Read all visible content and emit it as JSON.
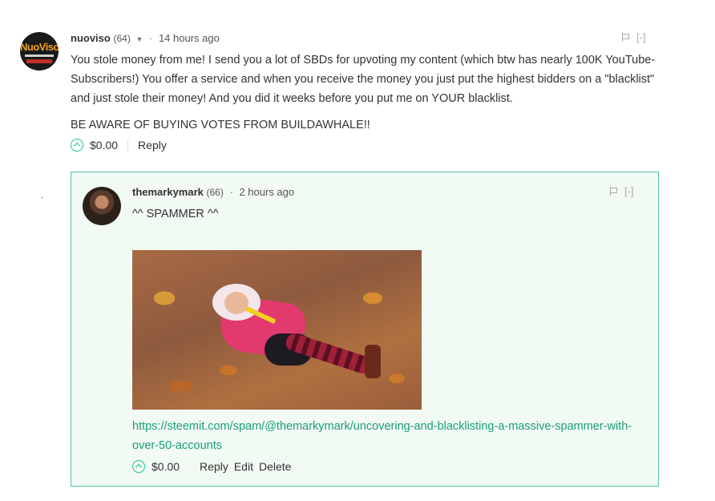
{
  "parent_comment": {
    "author": "nuoviso",
    "reputation": "(64)",
    "time": "14 hours ago",
    "avatar_text": "NuoViso",
    "collapse_label": "[-]",
    "paragraphs": [
      "You stole money from me! I send you a lot of SBDs for upvoting my content (which btw has nearly 100K YouTube-Subscribers!) You offer a service and when you receive the money you just put the highest bidders on a \"blacklist\" and just stole their money! And you did it weeks before you put me on YOUR blacklist.",
      "BE AWARE OF BUYING VOTES FROM BUILDAWHALE!!"
    ],
    "payout": "$0.00",
    "reply_label": "Reply"
  },
  "reply_comment": {
    "author": "themarkymark",
    "reputation": "(66)",
    "time": "2 hours ago",
    "collapse_label": "[-]",
    "text": "^^ SPAMMER ^^",
    "link": "https://steemit.com/spam/@themarkymark/uncovering-and-blacklisting-a-massive-spammer-with-over-50-accounts",
    "payout": "$0.00",
    "reply_label": "Reply",
    "edit_label": "Edit",
    "delete_label": "Delete"
  },
  "stray_text": ".",
  "colors": {
    "accent": "#1b9e77",
    "reply_border": "#4fc5a0",
    "reply_background": "#f1faf3"
  }
}
